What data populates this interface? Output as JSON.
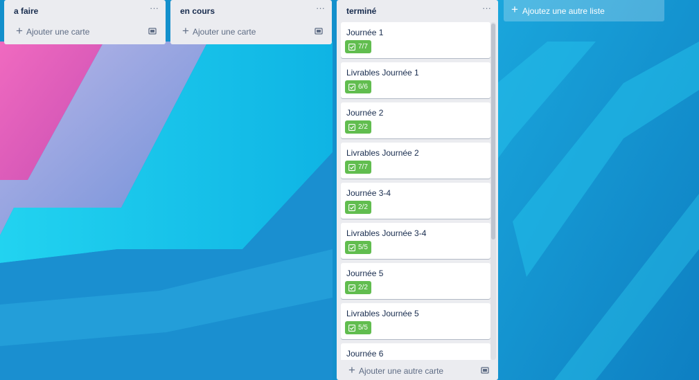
{
  "lists": [
    {
      "title": "a faire",
      "menu": "···",
      "add_card_label": "Ajouter une carte"
    },
    {
      "title": "en cours",
      "menu": "···",
      "add_card_label": "Ajouter une carte"
    },
    {
      "title": "terminé",
      "menu": "···",
      "add_card_label": "Ajouter une autre carte",
      "cards": [
        {
          "title": "Journée 1",
          "checklist": "7/7"
        },
        {
          "title": "Livrables Journée 1",
          "checklist": "6/6"
        },
        {
          "title": "Journée 2",
          "checklist": "2/2"
        },
        {
          "title": "Livrables Journée 2",
          "checklist": "7/7"
        },
        {
          "title": "Journée 3-4",
          "checklist": "2/2"
        },
        {
          "title": "Livrables Journée 3-4",
          "checklist": "5/5"
        },
        {
          "title": "Journée 5",
          "checklist": "2/2"
        },
        {
          "title": "Livrables Journée 5",
          "checklist": "5/5"
        },
        {
          "title": "Journée 6",
          "checklist": ""
        }
      ]
    }
  ],
  "add_list_label": "Ajoutez une autre liste",
  "icons": {
    "add": "plus-icon",
    "template": "card-template-icon",
    "checklist": "checklist-icon",
    "menu": "list-menu-icon"
  },
  "colors": {
    "list_bg": "#ebecf0",
    "badge_complete": "#61bd4f",
    "card_text": "#172b4d"
  }
}
